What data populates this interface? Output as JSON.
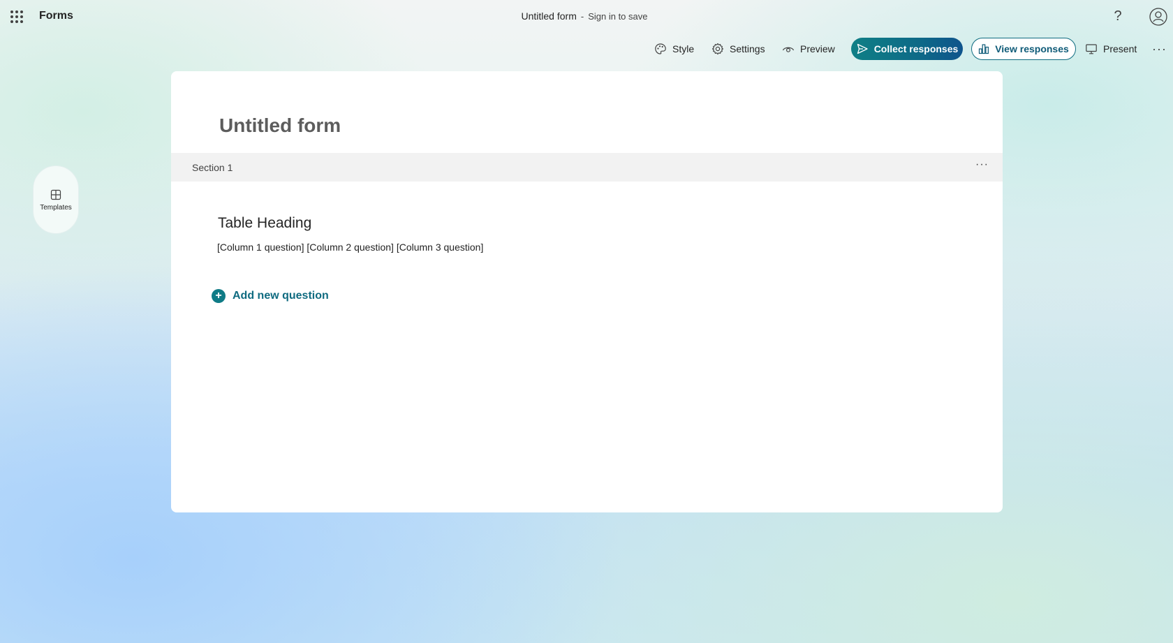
{
  "header": {
    "app_name": "Forms",
    "doc_title": "Untitled form",
    "separator": "-",
    "save_hint": "Sign in to save",
    "help_glyph": "?"
  },
  "toolbar": {
    "style_label": "Style",
    "settings_label": "Settings",
    "preview_label": "Preview",
    "collect_label": "Collect responses",
    "view_label": "View responses",
    "present_label": "Present",
    "more_glyph": "···"
  },
  "sidebar": {
    "templates_label": "Templates"
  },
  "form": {
    "title": "Untitled form",
    "section_label": "Section 1",
    "section_more_glyph": "···",
    "question_heading": "Table Heading",
    "question_columns": "[Column 1 question] [Column 2 question] [Column 3 question]",
    "add_question_label": "Add new question"
  },
  "colors": {
    "accent": "#0f7b86",
    "accent_dark": "#0f548c",
    "text": "#242424"
  },
  "icons": [
    "waffle-icon",
    "help-icon",
    "avatar-icon",
    "palette-icon",
    "gear-icon",
    "eye-icon",
    "send-icon",
    "chart-icon",
    "present-icon",
    "more-icon",
    "templates-icon",
    "plus-icon"
  ]
}
